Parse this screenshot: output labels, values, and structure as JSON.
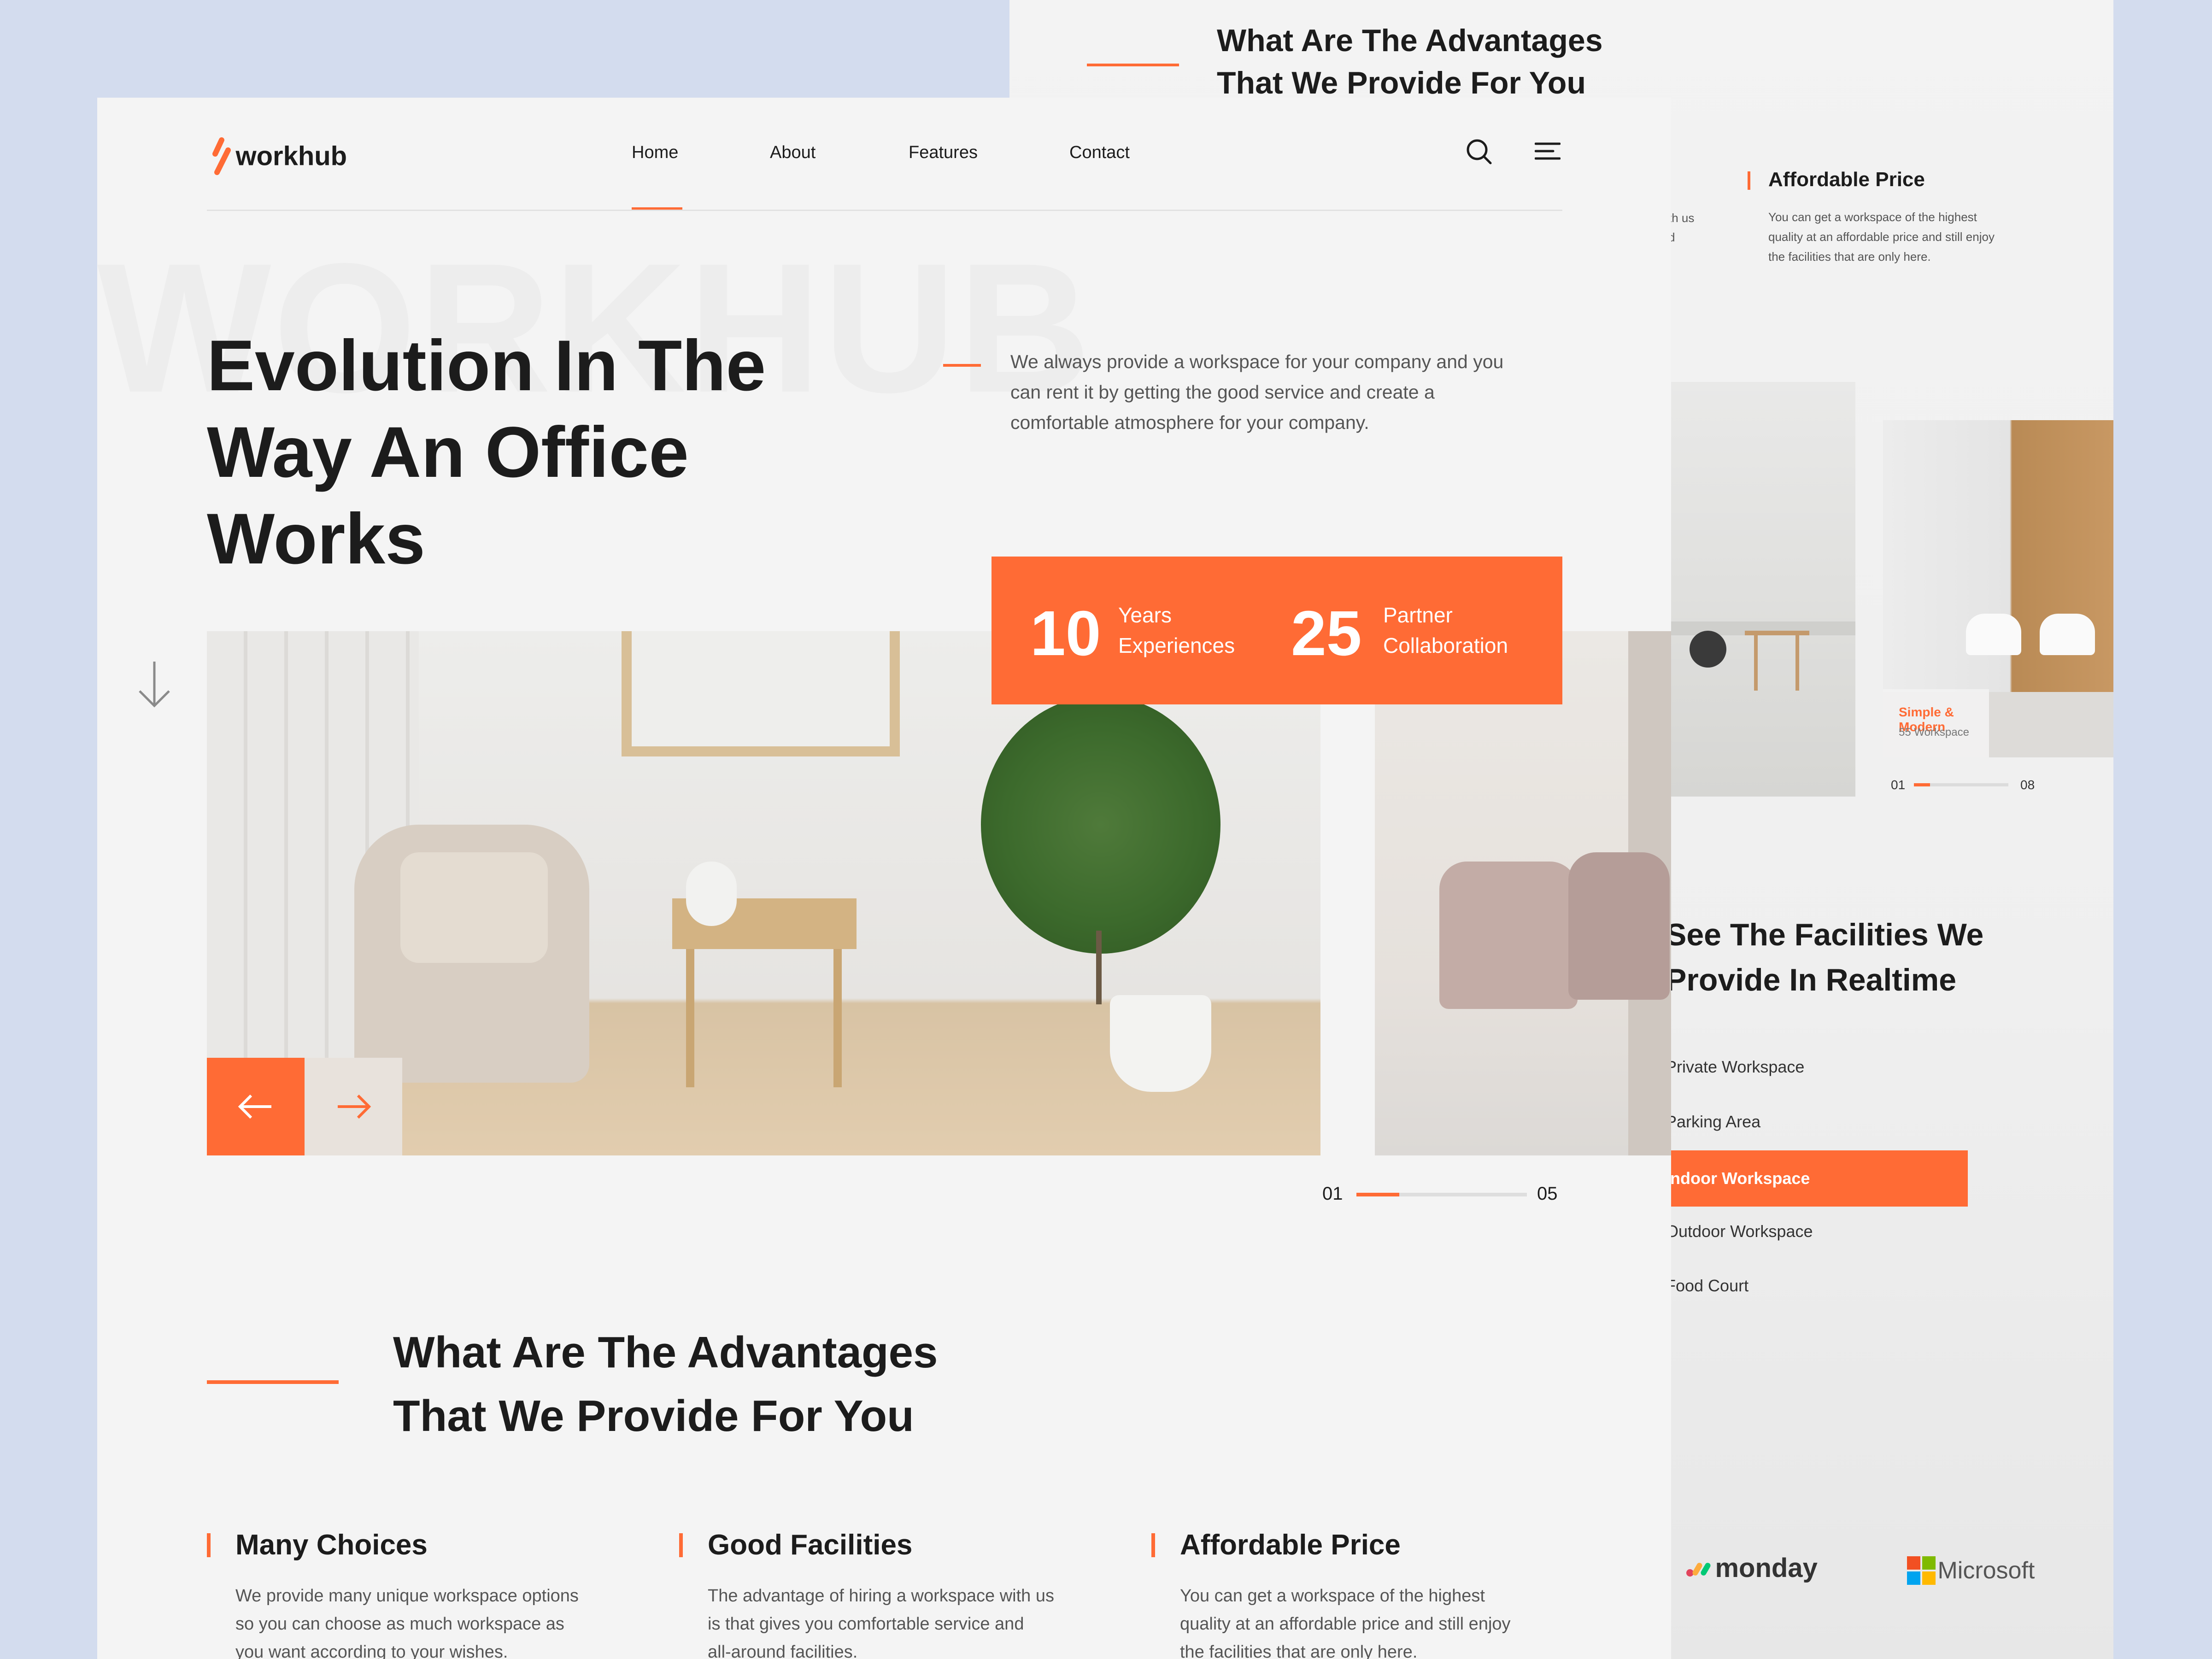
{
  "colors": {
    "accent": "#ff6b35",
    "background": "#d3dcee",
    "surface": "#f4f4f4",
    "text": "#1c1c1c"
  },
  "back": {
    "advantages_heading_line1": "What Are The Advantages",
    "advantages_heading_line2": "That We Provide For You",
    "partial_text_line1": "th us",
    "partial_text_line2": "d",
    "affordable": {
      "title": "Affordable Price",
      "text_lines": [
        "You can get a workspace of the highest",
        "quality at an affordable price and still enjoy",
        "the facilities that are only here."
      ]
    },
    "card": {
      "title": "Simple & Modern",
      "subtitle": "55 Workspace"
    },
    "pager": {
      "current": "01",
      "total": "08",
      "progress": 0.17
    },
    "facilities_heading_line1": "See The Facilities We",
    "facilities_heading_line2": "Provide In Realtime",
    "facilities": [
      {
        "label": "Private Workspace",
        "active": false
      },
      {
        "label": "Parking Area",
        "active": false
      },
      {
        "label": "Indoor Workspace",
        "active": true
      },
      {
        "label": "Outdoor Workspace",
        "active": false
      },
      {
        "label": "Food Court",
        "active": false
      }
    ],
    "partners": [
      {
        "name": "monday"
      },
      {
        "name": "Microsoft"
      }
    ]
  },
  "header": {
    "logo": "workhub",
    "nav": [
      {
        "label": "Home",
        "active": true
      },
      {
        "label": "About"
      },
      {
        "label": "Features"
      },
      {
        "label": "Contact"
      }
    ],
    "search_icon": "search-icon",
    "menu_icon": "menu-icon"
  },
  "hero": {
    "watermark": "WORKHUB",
    "title_line1": "Evolution In The",
    "title_line2": "Way An Office",
    "title_line3": "Works",
    "description_lines": [
      "We always provide a workspace for your company and you",
      "can rent it by getting the good service and create a",
      "comfortable atmosphere for your company."
    ],
    "stats": [
      {
        "number": "10",
        "label_line1": "Years",
        "label_line2": "Experiences"
      },
      {
        "number": "25",
        "label_line1": "Partner",
        "label_line2": "Collaboration"
      }
    ],
    "pager": {
      "current": "01",
      "total": "05",
      "progress": 0.25
    }
  },
  "advantages": {
    "heading_line1": "What Are The Advantages",
    "heading_line2": "That We Provide For You",
    "features": [
      {
        "title": "Many Choices",
        "lines": [
          "We provide many unique workspace options",
          "so you can choose as much workspace as",
          "you want according to your wishes."
        ]
      },
      {
        "title": "Good Facilities",
        "lines": [
          "The advantage of hiring a workspace with us",
          "is that gives you comfortable service and",
          "all-around facilities."
        ]
      },
      {
        "title": "Affordable Price",
        "lines": [
          "You can get a workspace of the highest",
          "quality at an affordable price and still enjoy",
          "the facilities that are only here."
        ]
      }
    ]
  }
}
